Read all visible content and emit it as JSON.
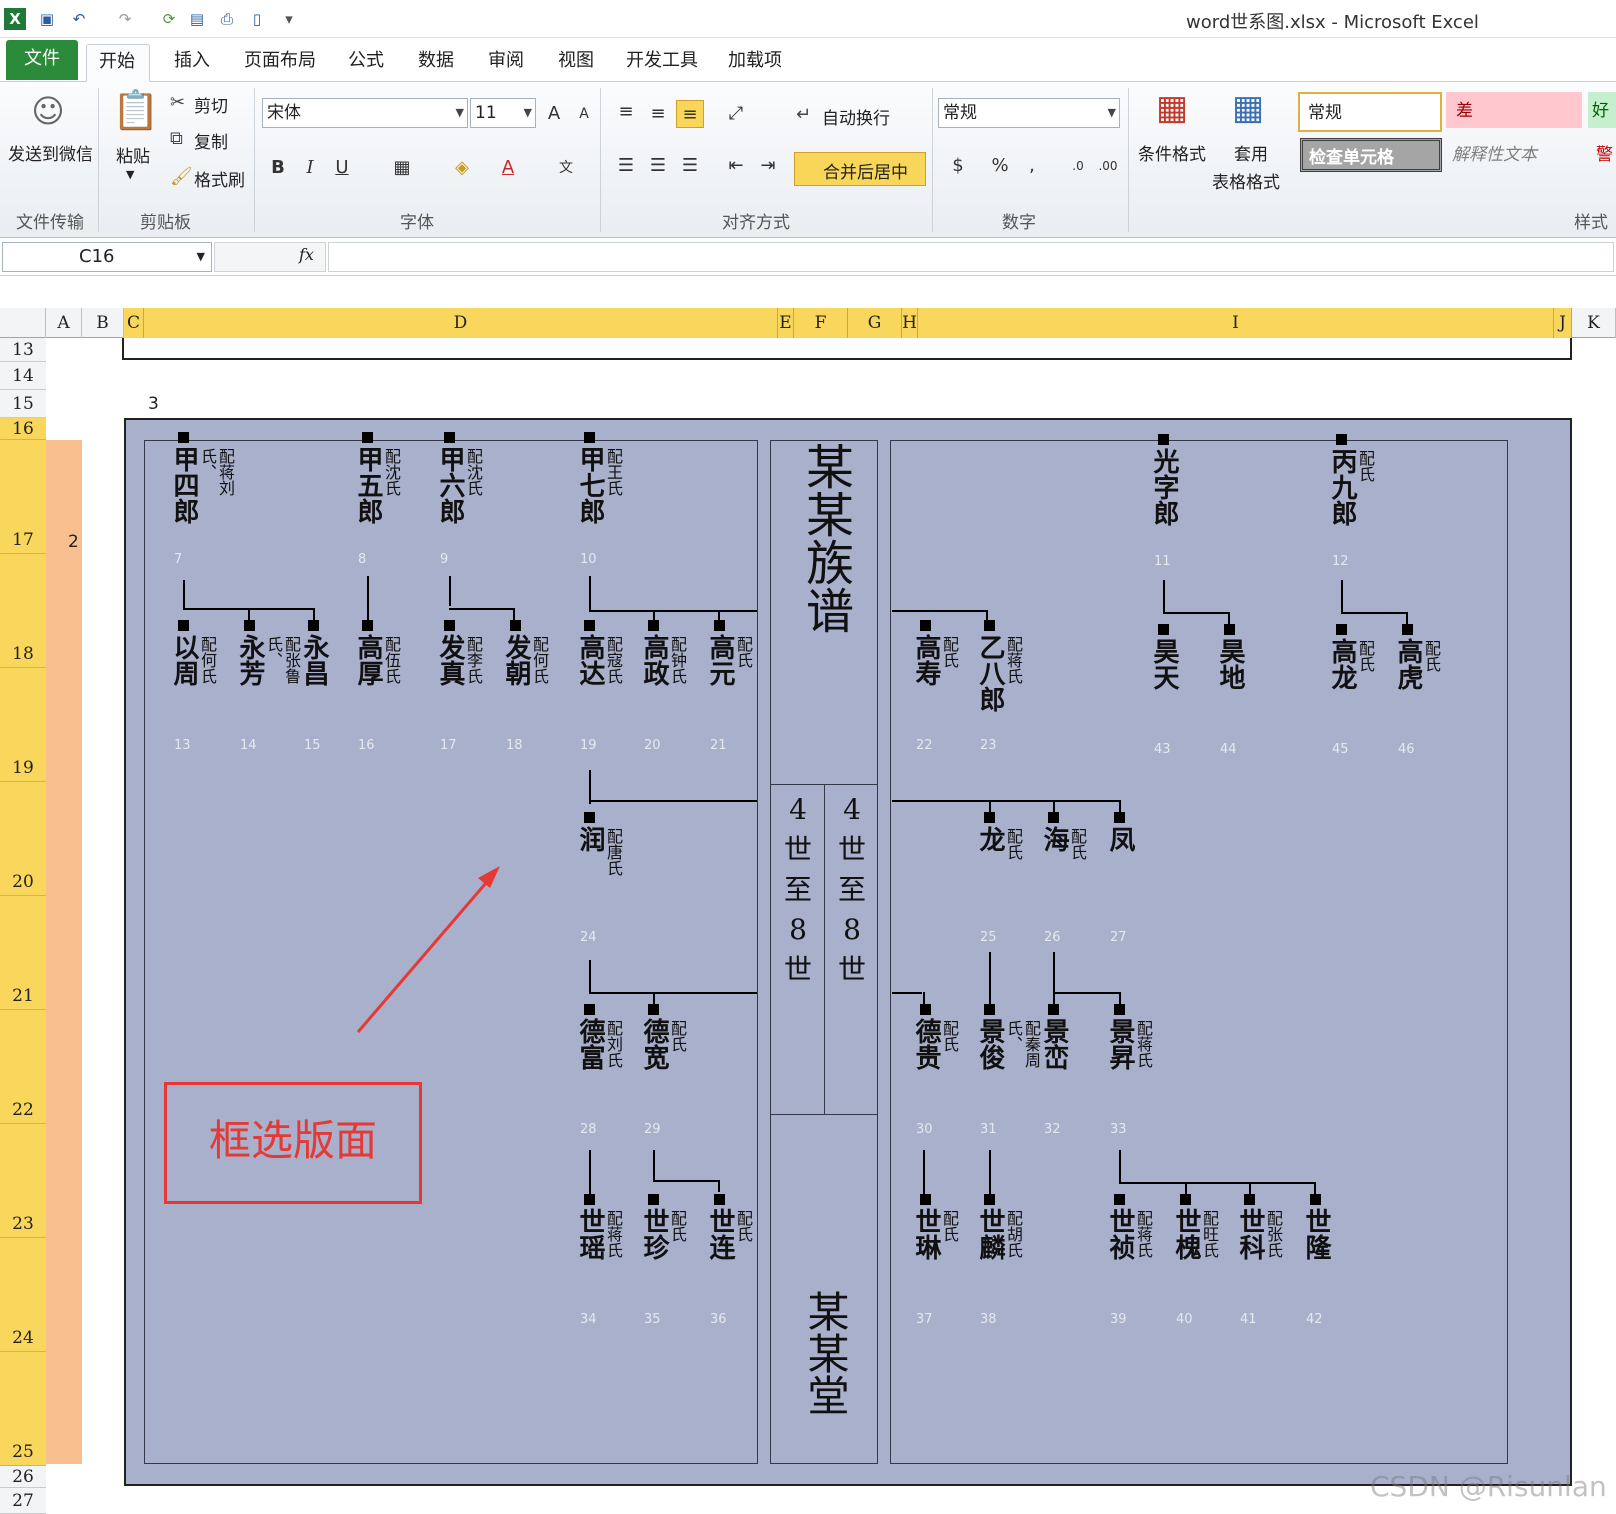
{
  "window": {
    "title": "word世系图.xlsx - Microsoft Excel"
  },
  "tabs": [
    "文件",
    "开始",
    "插入",
    "页面布局",
    "公式",
    "数据",
    "审阅",
    "视图",
    "开发工具",
    "加载项"
  ],
  "ribbon": {
    "wechat": "发送到微信",
    "grp_transfer": "文件传输",
    "paste": "粘贴",
    "cut": "剪切",
    "copy": "复制",
    "format_painter": "格式刷",
    "grp_clipboard": "剪贴板",
    "font": "宋体",
    "size": "11",
    "grp_font": "字体",
    "wrap": "自动换行",
    "merge": "合并后居中",
    "grp_align": "对齐方式",
    "numfmt": "常规",
    "grp_number": "数字",
    "cond": "条件格式",
    "table1": "套用",
    "table2": "表格格式",
    "style_normal": "常规",
    "style_bad": "差",
    "style_good": "好",
    "style_check": "检查单元格",
    "style_explain": "解释性文本",
    "style_warn": "警",
    "grp_style": "样式"
  },
  "formula": {
    "namebox": "C16",
    "fx": "fx",
    "value": ""
  },
  "columns": [
    "A",
    "B",
    "C",
    "D",
    "E",
    "F",
    "G",
    "H",
    "I",
    "J",
    "K"
  ],
  "rows": [
    "13",
    "14",
    "15",
    "16",
    "17",
    "18",
    "19",
    "20",
    "21",
    "22",
    "23",
    "24",
    "25",
    "26",
    "27"
  ],
  "cells": {
    "c15": "3",
    "a17": "2"
  },
  "genealogy": {
    "title": "某某族谱",
    "hall": "某某堂",
    "gen1": "4",
    "gen2": "4",
    "shi": "世",
    "zhi": "至",
    "gen_end": "8",
    "nodes": [
      {
        "name": "甲四郎",
        "pei": "配蒋刘氏、",
        "num": "7"
      },
      {
        "name": "甲五郎",
        "pei": "配沈氏",
        "num": "8"
      },
      {
        "name": "甲六郎",
        "pei": "配沈氏",
        "num": "9"
      },
      {
        "name": "甲七郎",
        "pei": "配王氏",
        "num": "10"
      },
      {
        "name": "光字郎",
        "pei": "",
        "num": "11"
      },
      {
        "name": "丙九郎",
        "pei": "配氏",
        "num": "12"
      },
      {
        "name": "以周",
        "pei": "配何氏",
        "num": "13"
      },
      {
        "name": "永芳",
        "pei": "配张鲁氏、",
        "num": "14"
      },
      {
        "name": "永昌",
        "pei": "",
        "num": "15"
      },
      {
        "name": "高厚",
        "pei": "配伍氏",
        "num": "16"
      },
      {
        "name": "发真",
        "pei": "配李氏",
        "num": "17"
      },
      {
        "name": "发朝",
        "pei": "配何氏",
        "num": "18"
      },
      {
        "name": "高达",
        "pei": "配寇氏",
        "num": "19"
      },
      {
        "name": "高政",
        "pei": "配钟氏",
        "num": "20"
      },
      {
        "name": "高元",
        "pei": "配氏",
        "num": "21"
      },
      {
        "name": "高寿",
        "pei": "配氏",
        "num": "22"
      },
      {
        "name": "乙八郎",
        "pei": "配蒋氏",
        "num": "23"
      },
      {
        "name": "昊天",
        "pei": "",
        "num": "43"
      },
      {
        "name": "昊地",
        "pei": "",
        "num": "44"
      },
      {
        "name": "高龙",
        "pei": "配氏",
        "num": "45"
      },
      {
        "name": "高虎",
        "pei": "配氏",
        "num": "46"
      },
      {
        "name": "润",
        "pei": "配唐氏",
        "num": "24"
      },
      {
        "name": "龙",
        "pei": "配氏",
        "num": "25"
      },
      {
        "name": "海",
        "pei": "配氏",
        "num": "26"
      },
      {
        "name": "凤",
        "pei": "",
        "num": "27"
      },
      {
        "name": "德富",
        "pei": "配刘氏",
        "num": "28"
      },
      {
        "name": "德宽",
        "pei": "配氏",
        "num": "29"
      },
      {
        "name": "德贵",
        "pei": "配氏",
        "num": "30"
      },
      {
        "name": "景俊",
        "pei": "配秦周氏、",
        "num": "31"
      },
      {
        "name": "景峦",
        "pei": "",
        "num": "32"
      },
      {
        "name": "景昇",
        "pei": "配蒋氏",
        "num": "33"
      },
      {
        "name": "世瑶",
        "pei": "配蒋氏",
        "num": "34"
      },
      {
        "name": "世珍",
        "pei": "配氏",
        "num": "35"
      },
      {
        "name": "世连",
        "pei": "配氏",
        "num": "36"
      },
      {
        "name": "世琳",
        "pei": "配氏",
        "num": "37"
      },
      {
        "name": "世麟",
        "pei": "配胡氏",
        "num": "38"
      },
      {
        "name": "世祯",
        "pei": "配蒋氏",
        "num": "39"
      },
      {
        "name": "世槐",
        "pei": "配旺氏",
        "num": "40"
      },
      {
        "name": "世科",
        "pei": "配张氏",
        "num": "41"
      },
      {
        "name": "世隆",
        "pei": "",
        "num": "42"
      }
    ]
  },
  "annotation": "框选版面",
  "watermark": "CSDN @Risunlan"
}
